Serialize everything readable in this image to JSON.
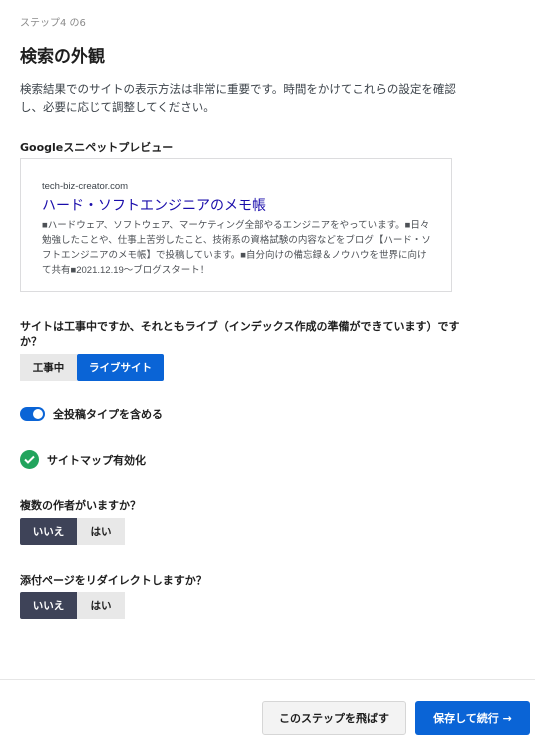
{
  "header": {
    "step": "ステップ4 の6",
    "title": "検索の外観",
    "description": "検索結果でのサイトの表示方法は非常に重要です。時間をかけてこれらの設定を確認し、必要に応じて調整してください。"
  },
  "snippet": {
    "label": "Googleスニペットプレビュー",
    "url": "tech-biz-creator.com",
    "title": "ハード・ソフトエンジニアのメモ帳",
    "description": "■ハードウェア、ソフトウェア、マーケティング全部やるエンジニアをやっています。■日々勉強したことや、仕事上苦労したこと、技術系の資格試験の内容などをブログ【ハード・ソフトエンジニアのメモ帳】で投稿しています。■自分向けの備忘録＆ノウハウを世界に向けて共有■2021.12.19～ブログスタート！"
  },
  "site_status": {
    "question": "サイトは工事中ですか、それともライブ（インデックス作成の準備ができています）ですか？",
    "options": [
      "工事中",
      "ライブサイト"
    ],
    "selected": "ライブサイト"
  },
  "include_post_types": {
    "label": "全投稿タイプを含める",
    "enabled": true
  },
  "sitemap": {
    "label": "サイトマップ有効化",
    "enabled": true
  },
  "multiple_authors": {
    "question": "複数の作者がいますか？",
    "options": [
      "いいえ",
      "はい"
    ],
    "selected": "いいえ"
  },
  "attachment_redirect": {
    "question": "添付ページをリダイレクトしますか？",
    "options": [
      "いいえ",
      "はい"
    ],
    "selected": "いいえ"
  },
  "footer": {
    "skip_label": "このステップを飛ばす",
    "save_label": "保存して続行 →"
  },
  "colors": {
    "accent": "#0a64d6",
    "dark_selected": "#3e4358",
    "success": "#22a45d",
    "snippet_title": "#1a0dab"
  }
}
